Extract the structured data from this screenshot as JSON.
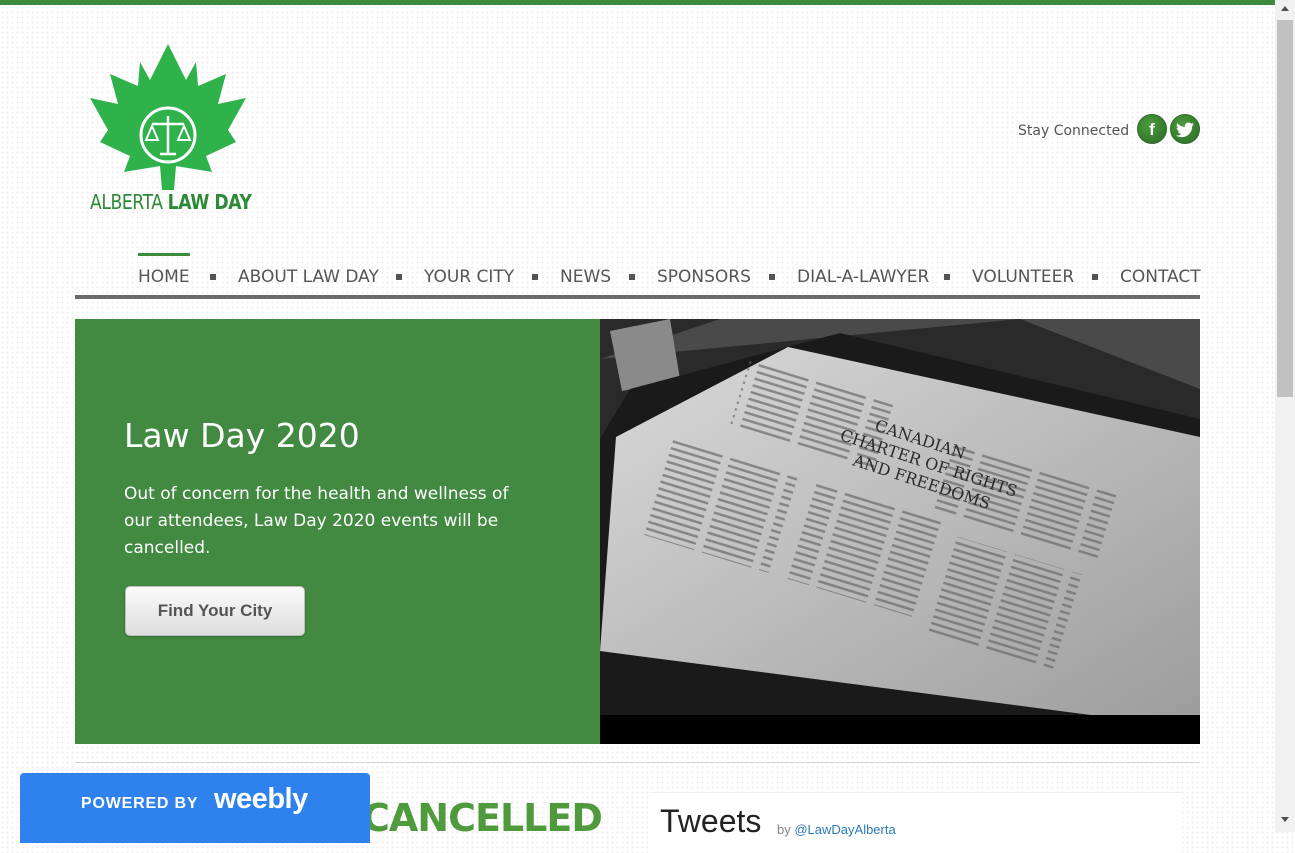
{
  "colors": {
    "brand_green": "#3c8a3c",
    "hero_green": "#428a41",
    "logo_green": "#2fb24a",
    "weebly_blue": "#2f82ee"
  },
  "logo": {
    "text_light": "ALBERTA ",
    "text_bold": "LAW DAY",
    "icon": "maple-leaf-scales-icon"
  },
  "social": {
    "label": "Stay Connected",
    "facebook_glyph": "f",
    "twitter_glyph": "🐦"
  },
  "nav": {
    "items": [
      "HOME",
      "ABOUT LAW DAY",
      "YOUR CITY",
      "NEWS",
      "SPONSORS",
      "DIAL-A-LAWYER",
      "VOLUNTEER",
      "CONTACT"
    ],
    "active": "HOME"
  },
  "hero": {
    "title": "Law Day 2020",
    "text": "Out of concern for the health and wellness of our attendees, Law Day 2020 events will be cancelled.",
    "button": "Find Your City",
    "image_caption_line1": "CANADIAN",
    "image_caption_line2": "CHARTER OF RIGHTS",
    "image_caption_line3": "AND FREEDOMS"
  },
  "content": {
    "cancelled_heading": "CANCELLED"
  },
  "tweets": {
    "title": "Tweets",
    "by": "by",
    "handle": "@LawDayAlberta"
  },
  "weebly": {
    "powered_by": "POWERED BY",
    "brand": "weebly"
  }
}
